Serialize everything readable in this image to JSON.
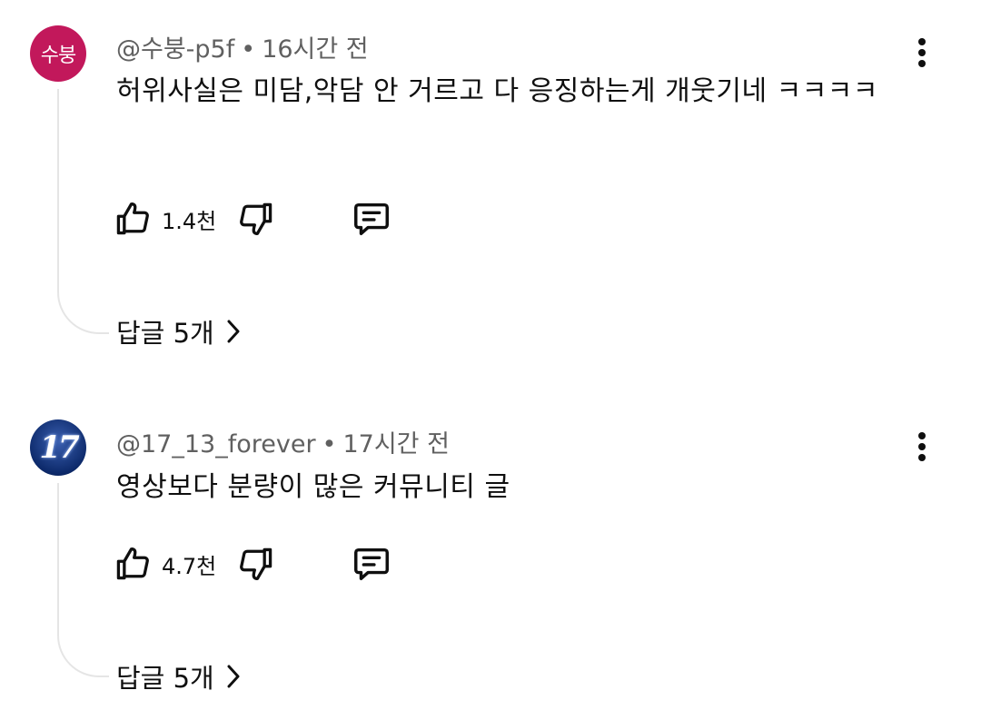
{
  "comments": [
    {
      "avatar_text": "수붕",
      "avatar_color": "#c2185b",
      "author": "@수붕-p5f",
      "separator": "•",
      "time": "16시간 전",
      "text": "허위사실은 미담,악담 안 거르고 다 응징하는게 개웃기네 ㅋㅋㅋㅋ",
      "likes": "1.4천",
      "replies": "답글 5개"
    },
    {
      "avatar_text": "17",
      "avatar_color": "#0d2a6b",
      "author": "@17_13_forever",
      "separator": "•",
      "time": "17시간 전",
      "text": "영상보다 분량이 많은 커뮤니티 글",
      "likes": "4.7천",
      "replies": "답글 5개"
    }
  ],
  "icons": {
    "like": "thumbs-up-icon",
    "dislike": "thumbs-down-icon",
    "reply": "reply-comment-icon",
    "more": "more-vertical-icon",
    "chevron": "chevron-right-icon"
  }
}
